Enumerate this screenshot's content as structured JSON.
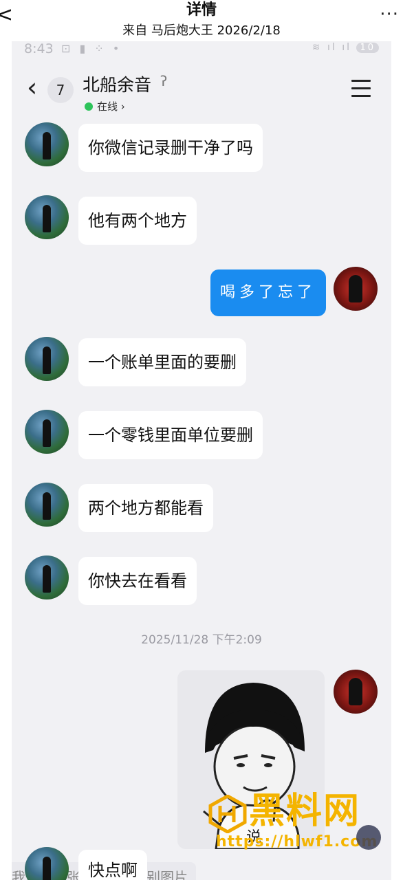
{
  "outer": {
    "title": "详情",
    "subtitle": "来自 马后炮大王 2026/2/18",
    "back_glyph": "<",
    "more_glyph": "···"
  },
  "status": {
    "time": "8:43",
    "icons": "⊡ ▮ ⁘ •",
    "signal": "≋ ıl ıl",
    "battery": "10"
  },
  "chat": {
    "back_glyph": "‹",
    "unread": "7",
    "contact_name": "北船余音",
    "ear_glyph": "ʔ",
    "online": "在线",
    "online_chevron": "›",
    "timestamp": "2025/11/28 下午2:09"
  },
  "messages": [
    {
      "text": "你微信记录删干净了吗",
      "from": "friend"
    },
    {
      "text": "他有两个地方",
      "from": "friend"
    },
    {
      "text": "喝多了忘了",
      "from": "me"
    },
    {
      "text": "一个账单里面的要删",
      "from": "friend"
    },
    {
      "text": "一个零钱里面单位要删",
      "from": "friend"
    },
    {
      "text": "两个地方都能看",
      "from": "friend"
    },
    {
      "text": "你快去在看看",
      "from": "friend"
    },
    {
      "text": "快点啊",
      "from": "friend"
    }
  ],
  "sticker": {
    "caption": "说"
  },
  "bottom": {
    "send_too": "我也发一张",
    "recognize": "⊙ 识别图片"
  },
  "watermark": {
    "text": "黑料网",
    "url": "https://hlwf1.com"
  },
  "colors": {
    "chat_bg": "#f1f1f4",
    "my_bubble": "#1a8cf0",
    "online_dot": "#2dc35a",
    "watermark": "#f4b400"
  }
}
